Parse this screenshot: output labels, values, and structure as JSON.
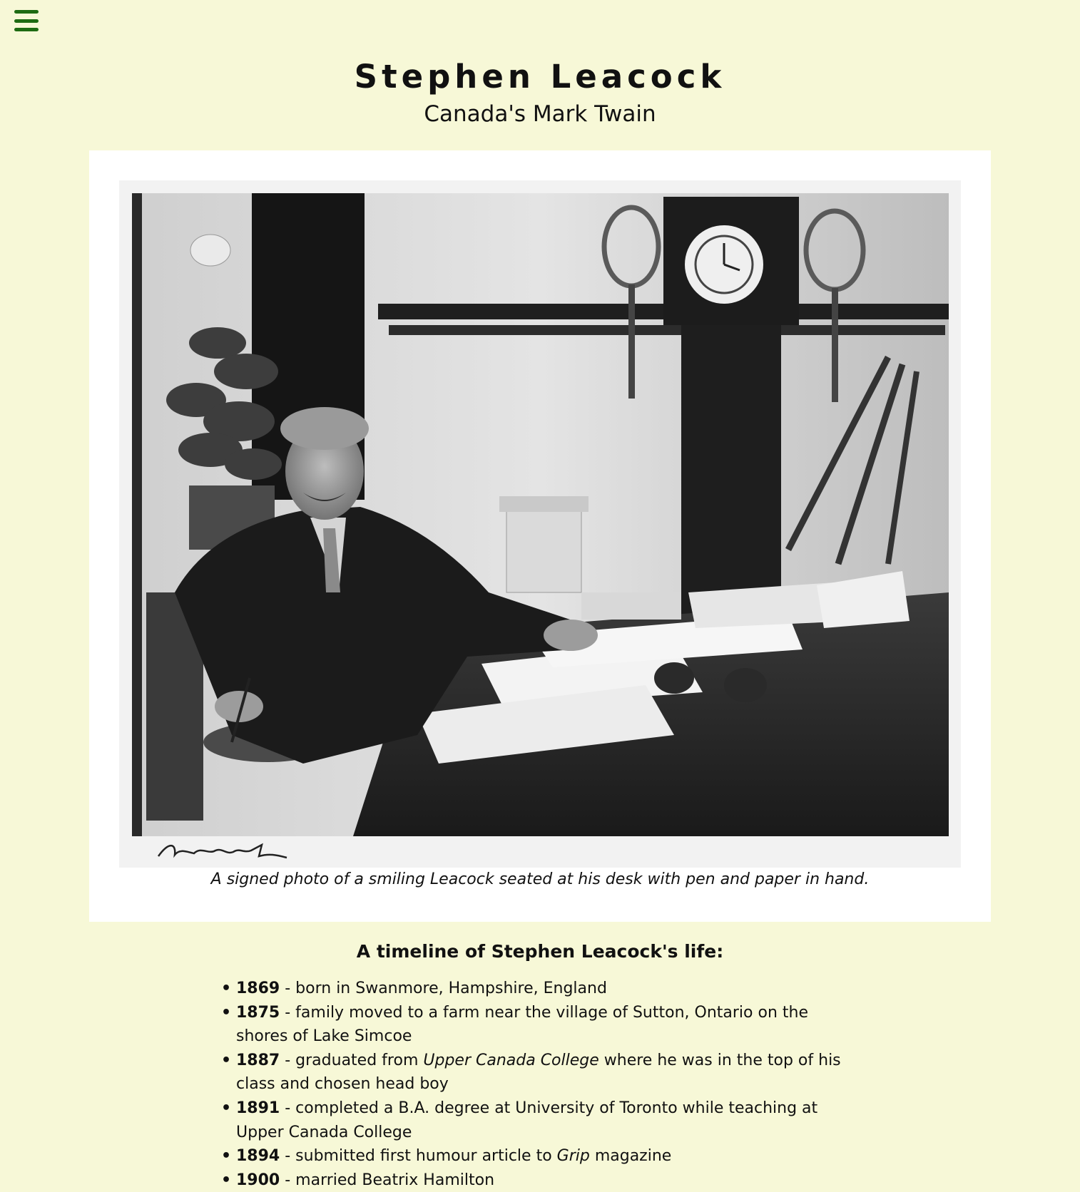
{
  "nav": {
    "menu_icon": "hamburger-menu-icon",
    "accent_color": "#1e6b12"
  },
  "header": {
    "title": "Stephen Leacock",
    "subtitle": "Canada's Mark Twain"
  },
  "photo": {
    "caption": "A signed photo of a smiling Leacock seated at his desk with pen and paper in hand."
  },
  "timeline": {
    "heading": "A timeline of Stephen Leacock's life:",
    "items": [
      {
        "year": "1869",
        "sep": " - ",
        "text_before": "born in Swanmore, Hampshire, England",
        "italic": "",
        "text_after": ""
      },
      {
        "year": "1875",
        "sep": " - ",
        "text_before": "family moved to a farm near the village of Sutton, Ontario on the shores of Lake Simcoe",
        "italic": "",
        "text_after": ""
      },
      {
        "year": "1887",
        "sep": " - ",
        "text_before": "graduated from ",
        "italic": "Upper Canada College",
        "text_after": " where he was in the top of his class and chosen head boy"
      },
      {
        "year": "1891",
        "sep": " - ",
        "text_before": "completed a B.A. degree at University of Toronto while teaching at Upper Canada College",
        "italic": "",
        "text_after": ""
      },
      {
        "year": "1894",
        "sep": " - ",
        "text_before": "submitted first humour article to ",
        "italic": "Grip",
        "text_after": " magazine"
      },
      {
        "year": "1900",
        "sep": " - ",
        "text_before": "married Beatrix Hamilton",
        "italic": "",
        "text_after": ""
      }
    ]
  }
}
